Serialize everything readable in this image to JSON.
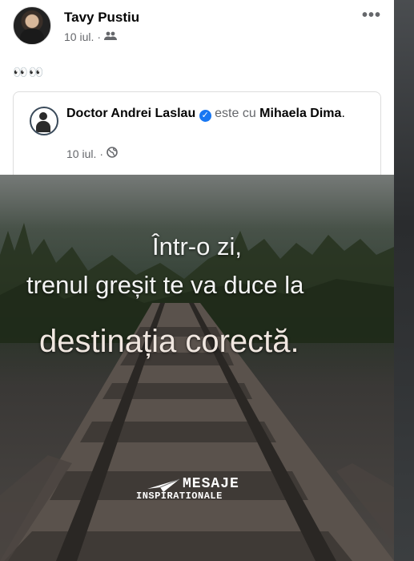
{
  "post": {
    "author": "Tavy Pustiu",
    "time": "10 iul.",
    "separator": "·",
    "audience_icon": "friends-icon",
    "more_label": "•••",
    "text": "👀👀"
  },
  "shared_post": {
    "author": "Doctor Andrei Laslau",
    "verified_icon": "verified-badge-icon",
    "with_text": "este cu",
    "tagged": "Mihaela Dima",
    "tagged_end": ".",
    "time": "10 iul.",
    "separator": "·",
    "audience_icon": "globe-icon"
  },
  "image": {
    "line1": "Într-o zi,",
    "line2": "trenul greșit te va duce la",
    "line3": "destinația corectă.",
    "logo_main": "MESAJE",
    "logo_sub": "INSPIRATIONALE"
  },
  "colors": {
    "accent": "#1877f2",
    "meta": "#65676b"
  }
}
